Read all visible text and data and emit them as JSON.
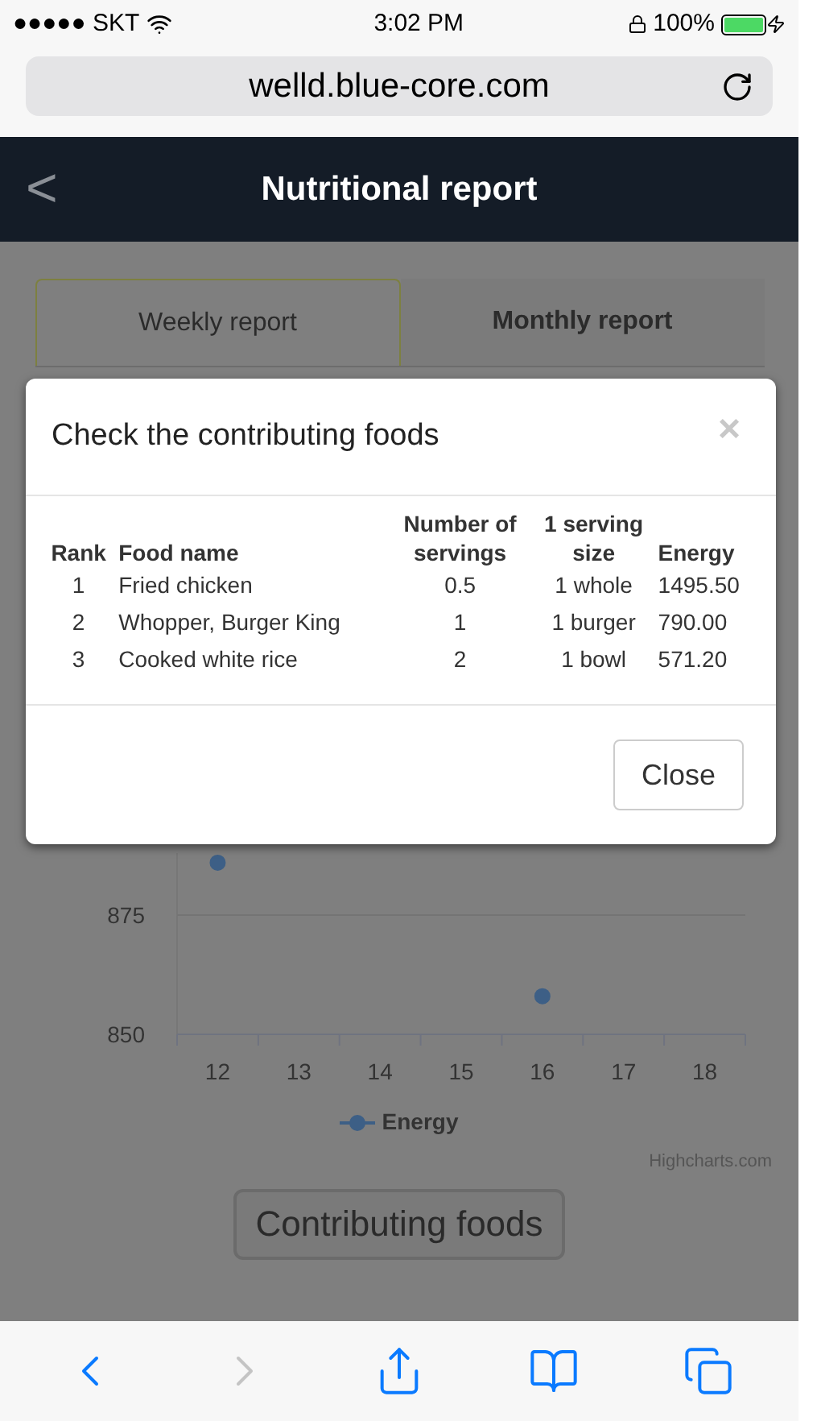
{
  "status_bar": {
    "carrier": "●●●●● SKT",
    "time": "3:02 PM",
    "battery": "100%"
  },
  "browser": {
    "url": "welld.blue-core.com"
  },
  "header": {
    "back": "<",
    "title": "Nutritional report"
  },
  "tabs": [
    {
      "label": "Weekly report",
      "selected": true
    },
    {
      "label": "Monthly report",
      "selected": false
    }
  ],
  "chart": {
    "chart_data": {
      "type": "scatter",
      "categories": [
        "12",
        "13",
        "14",
        "15",
        "16",
        "17",
        "18"
      ],
      "series": [
        {
          "name": "Energy",
          "color": "#3d5f86",
          "values": [
            886,
            null,
            null,
            null,
            858,
            null,
            null
          ]
        }
      ],
      "ylim": [
        850,
        888
      ],
      "yticks": [
        850,
        875
      ]
    },
    "credit": "Highcharts.com"
  },
  "contributing_button": "Contributing foods",
  "modal": {
    "title": "Check the contributing foods",
    "close_icon": "×",
    "columns": [
      "Rank",
      "Food name",
      "Number of servings",
      "1 serving size",
      "Energy"
    ],
    "rows": [
      [
        "1",
        "Fried chicken",
        "0.5",
        "1 whole",
        "1495.50"
      ],
      [
        "2",
        "Whopper, Burger King",
        "1",
        "1 burger",
        "790.00"
      ],
      [
        "3",
        "Cooked white rice",
        "2",
        "1 bowl",
        "571.20"
      ]
    ],
    "button": "Close"
  }
}
